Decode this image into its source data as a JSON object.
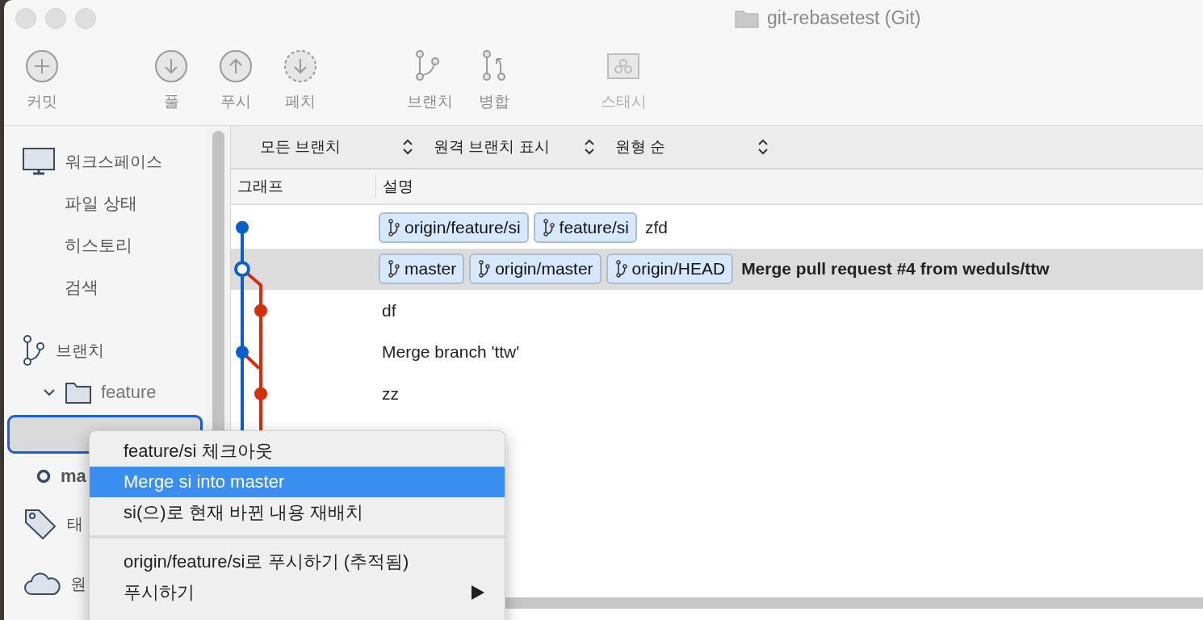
{
  "window": {
    "title": "git-rebasetest (Git)"
  },
  "toolbar": {
    "groups": [
      [
        {
          "kind": "commit",
          "label": "커밋",
          "disabled": false
        }
      ],
      [
        {
          "kind": "pull",
          "label": "풀",
          "disabled": false
        },
        {
          "kind": "push",
          "label": "푸시",
          "disabled": false
        },
        {
          "kind": "fetch",
          "label": "페치",
          "disabled": false
        }
      ],
      [
        {
          "kind": "branch",
          "label": "브랜치",
          "disabled": false
        },
        {
          "kind": "merge",
          "label": "병합",
          "disabled": false
        }
      ],
      [
        {
          "kind": "stash",
          "label": "스태시",
          "disabled": true
        }
      ]
    ]
  },
  "sidebar": {
    "workspace": {
      "label": "워크스페이스",
      "items": [
        "파일 상태",
        "히스토리",
        "검색"
      ]
    },
    "branches": {
      "label": "브랜치",
      "tree": [
        {
          "kind": "folder",
          "label": "feature",
          "expanded": true,
          "children": [
            {
              "kind": "branch",
              "selected": true
            }
          ]
        },
        {
          "kind": "branch",
          "label": "ma",
          "current": true,
          "selected": false
        }
      ]
    },
    "sections": [
      {
        "kind": "tags",
        "label": "태"
      },
      {
        "kind": "remotes",
        "label": "원"
      }
    ]
  },
  "filters": [
    {
      "label": "모든 브랜치"
    },
    {
      "label": "원격 브랜치 표시"
    },
    {
      "label": "원형 순"
    }
  ],
  "table": {
    "columns": [
      "그래프",
      "설명"
    ],
    "rows": [
      {
        "kind": "main",
        "selected": false,
        "current": false,
        "refs": [
          "origin/feature/si",
          "feature/si"
        ],
        "message": "zfd"
      },
      {
        "kind": "main",
        "selected": true,
        "current": true,
        "refs": [
          "master",
          "origin/master",
          "origin/HEAD"
        ],
        "message": "Merge pull request #4 from weduls/ttw"
      },
      {
        "kind": "branch",
        "selected": false,
        "current": false,
        "refs": [],
        "message": "df"
      },
      {
        "kind": "main",
        "selected": false,
        "current": false,
        "refs": [],
        "message": "Merge branch 'ttw'"
      },
      {
        "kind": "branch",
        "selected": false,
        "current": false,
        "refs": [],
        "message": "zz"
      }
    ]
  },
  "context_menu": {
    "items": [
      {
        "kind": "item",
        "label": "feature/si 체크아웃",
        "selected": false,
        "submenu": false
      },
      {
        "kind": "item",
        "label": "Merge si into master",
        "selected": true,
        "submenu": false
      },
      {
        "kind": "item",
        "label": "si(으)로 현재 바뀐 내용 재배치",
        "selected": false,
        "submenu": false
      },
      {
        "kind": "separator"
      },
      {
        "kind": "item",
        "label": "origin/feature/si로 푸시하기 (추적됨)",
        "selected": false,
        "submenu": false
      },
      {
        "kind": "item",
        "label": "푸시하기",
        "selected": false,
        "submenu": true
      }
    ]
  }
}
